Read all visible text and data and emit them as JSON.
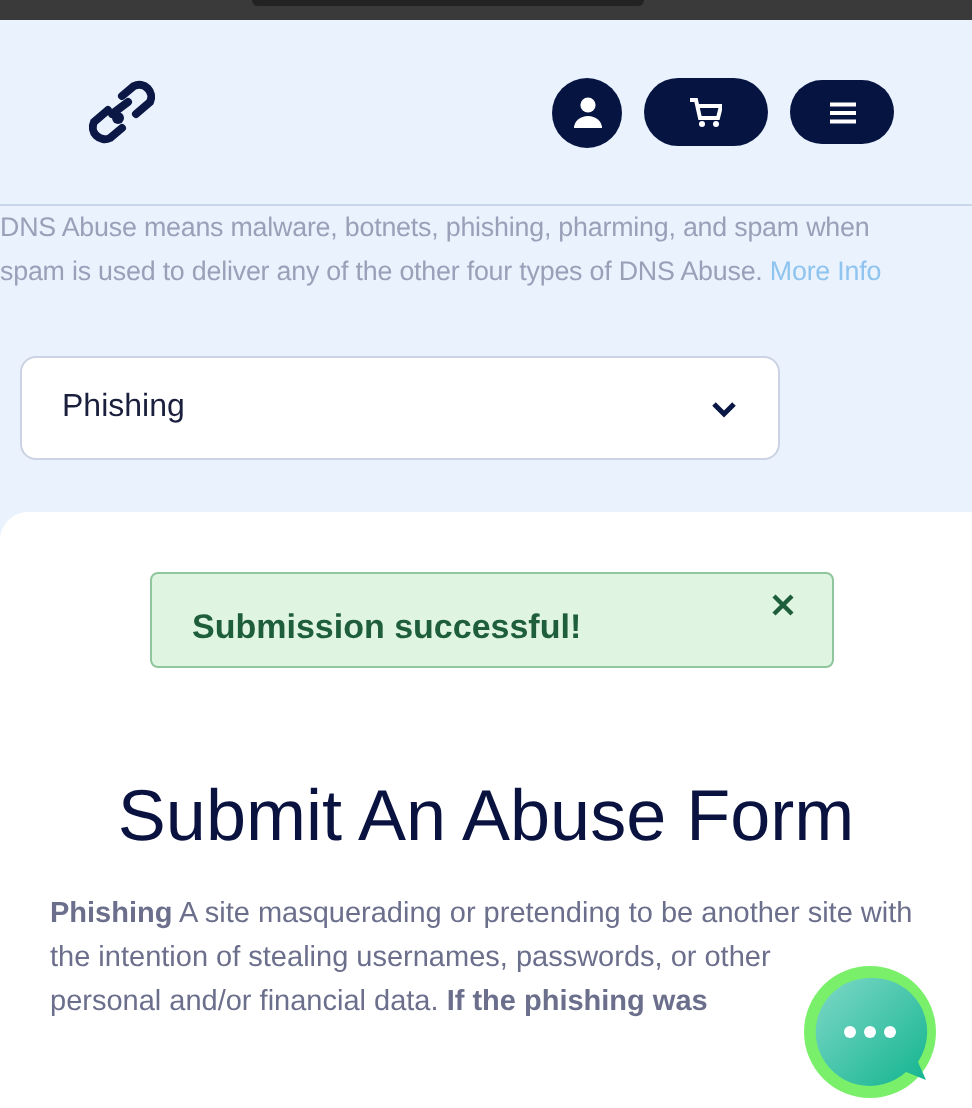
{
  "header": {
    "buttons": [
      {
        "kind": "account"
      },
      {
        "kind": "cart"
      },
      {
        "kind": "menu"
      }
    ]
  },
  "intro": {
    "text": "DNS Abuse means malware, botnets, phishing, pharming, and spam when spam is used to deliver any of the other four types of DNS Abuse.",
    "link": "More Info"
  },
  "abuse_type_select": {
    "value": "Phishing"
  },
  "alert": {
    "message": "Submission successful!"
  },
  "heading": "Submit An Abuse Form",
  "description": "**Phishing** A site masquerading or pretending to be another site with the intention of stealing usernames, passwords, or other personal and/or financial data. **If the phishing was**"
}
